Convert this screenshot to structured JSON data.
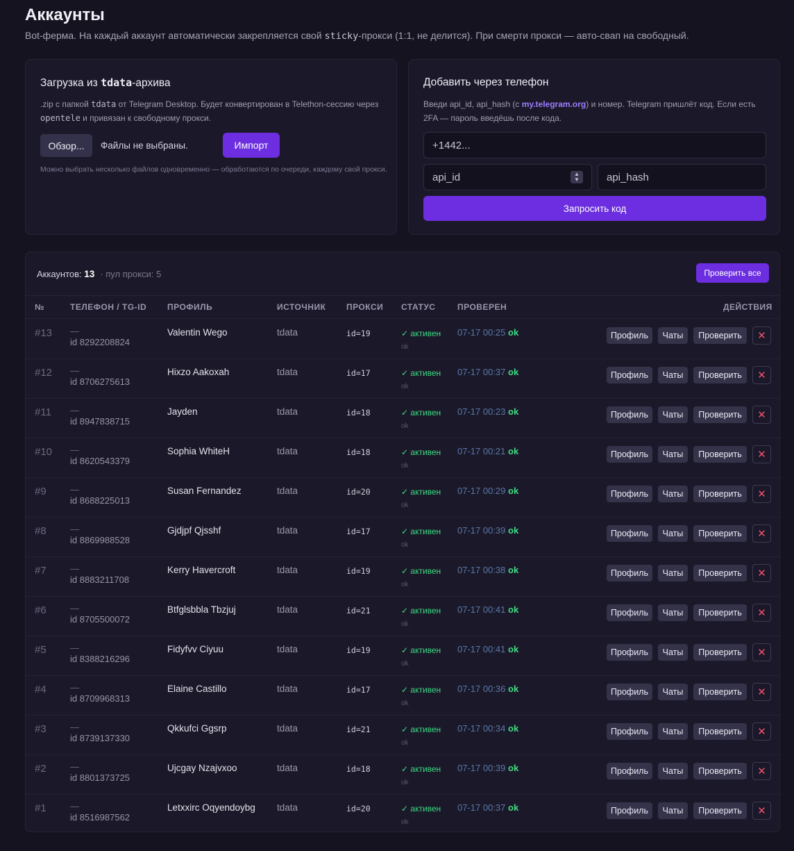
{
  "page": {
    "title": "Аккаунты",
    "subtitle_pre": "Bot-ферма. На каждый аккаунт автоматически закрепляется свой ",
    "subtitle_mono": "sticky",
    "subtitle_post": "-прокси (1:1, не делится). При смерти прокси — авто-свап на свободный."
  },
  "tdata_card": {
    "title_pre": "Загрузка из ",
    "title_mono": "tdata",
    "title_post": "-архива",
    "desc_1": ".zip с папкой ",
    "desc_mono1": "tdata",
    "desc_2": " от Telegram Desktop. Будет конвертирован в Telethon-сессию через ",
    "desc_mono2": "opentele",
    "desc_3": " и привязан к свободному прокси.",
    "browse_label": "Обзор...",
    "file_status": "Файлы не выбраны.",
    "import_label": "Импорт",
    "hint": "Можно выбрать несколько файлов одновременно — обработаются по очереди, каждому свой прокси."
  },
  "phone_card": {
    "title": "Добавить через телефон",
    "desc_1": "Введи api_id, api_hash (с ",
    "desc_link": "my.telegram.org",
    "desc_2": ") и номер. Telegram пришлёт код. Если есть 2FA — пароль введёшь после кода.",
    "phone_placeholder": "+1442...",
    "api_id_placeholder": "api_id",
    "api_hash_placeholder": "api_hash",
    "request_label": "Запросить код"
  },
  "table": {
    "accounts_label": "Аккаунтов:",
    "accounts_count": "13",
    "proxy_pool": "· пул прокси: 5",
    "check_all_label": "Проверить все",
    "headers": {
      "num": "№",
      "phone": "ТЕЛЕФОН / TG-ID",
      "profile": "ПРОФИЛЬ",
      "source": "ИСТОЧНИК",
      "proxy": "ПРОКСИ",
      "status": "СТАТУС",
      "checked": "ПРОВЕРЕН",
      "actions": "ДЕЙСТВИЯ"
    },
    "action_labels": {
      "profile": "Профиль",
      "chats": "Чаты",
      "check": "Проверить",
      "delete": "✕"
    },
    "rows": [
      {
        "num": "#13",
        "phone": "—",
        "tgid": "id 8292208824",
        "profile": "Valentin Wego",
        "source": "tdata",
        "proxy": "id=19",
        "status": "✓ активен",
        "status_sub": "ok",
        "checked": "07-17 00:25",
        "checked_ok": "ok"
      },
      {
        "num": "#12",
        "phone": "—",
        "tgid": "id 8706275613",
        "profile": "Hixzo Aakoxah",
        "source": "tdata",
        "proxy": "id=17",
        "status": "✓ активен",
        "status_sub": "ok",
        "checked": "07-17 00:37",
        "checked_ok": "ok"
      },
      {
        "num": "#11",
        "phone": "—",
        "tgid": "id 8947838715",
        "profile": "Jayden",
        "source": "tdata",
        "proxy": "id=18",
        "status": "✓ активен",
        "status_sub": "ok",
        "checked": "07-17 00:23",
        "checked_ok": "ok"
      },
      {
        "num": "#10",
        "phone": "—",
        "tgid": "id 8620543379",
        "profile": "Sophia WhiteH",
        "source": "tdata",
        "proxy": "id=18",
        "status": "✓ активен",
        "status_sub": "ok",
        "checked": "07-17 00:21",
        "checked_ok": "ok"
      },
      {
        "num": "#9",
        "phone": "—",
        "tgid": "id 8688225013",
        "profile": "Susan Fernandez",
        "source": "tdata",
        "proxy": "id=20",
        "status": "✓ активен",
        "status_sub": "ok",
        "checked": "07-17 00:29",
        "checked_ok": "ok"
      },
      {
        "num": "#8",
        "phone": "—",
        "tgid": "id 8869988528",
        "profile": "Gjdjpf Qjsshf",
        "source": "tdata",
        "proxy": "id=17",
        "status": "✓ активен",
        "status_sub": "ok",
        "checked": "07-17 00:39",
        "checked_ok": "ok"
      },
      {
        "num": "#7",
        "phone": "—",
        "tgid": "id 8883211708",
        "profile": "Kerry Havercroft",
        "source": "tdata",
        "proxy": "id=19",
        "status": "✓ активен",
        "status_sub": "ok",
        "checked": "07-17 00:38",
        "checked_ok": "ok"
      },
      {
        "num": "#6",
        "phone": "—",
        "tgid": "id 8705500072",
        "profile": "Btfglsbbla Tbzjuj",
        "source": "tdata",
        "proxy": "id=21",
        "status": "✓ активен",
        "status_sub": "ok",
        "checked": "07-17 00:41",
        "checked_ok": "ok"
      },
      {
        "num": "#5",
        "phone": "—",
        "tgid": "id 8388216296",
        "profile": "Fidyfvv Ciyuu",
        "source": "tdata",
        "proxy": "id=19",
        "status": "✓ активен",
        "status_sub": "ok",
        "checked": "07-17 00:41",
        "checked_ok": "ok"
      },
      {
        "num": "#4",
        "phone": "—",
        "tgid": "id 8709968313",
        "profile": "Elaine Castillo",
        "source": "tdata",
        "proxy": "id=17",
        "status": "✓ активен",
        "status_sub": "ok",
        "checked": "07-17 00:36",
        "checked_ok": "ok"
      },
      {
        "num": "#3",
        "phone": "—",
        "tgid": "id 8739137330",
        "profile": "Qkkufci Ggsrp",
        "source": "tdata",
        "proxy": "id=21",
        "status": "✓ активен",
        "status_sub": "ok",
        "checked": "07-17 00:34",
        "checked_ok": "ok"
      },
      {
        "num": "#2",
        "phone": "—",
        "tgid": "id 8801373725",
        "profile": "Ujcgay Nzajvxoo",
        "source": "tdata",
        "proxy": "id=18",
        "status": "✓ активен",
        "status_sub": "ok",
        "checked": "07-17 00:39",
        "checked_ok": "ok"
      },
      {
        "num": "#1",
        "phone": "—",
        "tgid": "id 8516987562",
        "profile": "Letxxirc Oqyendoybg",
        "source": "tdata",
        "proxy": "id=20",
        "status": "✓ активен",
        "status_sub": "ok",
        "checked": "07-17 00:37",
        "checked_ok": "ok"
      }
    ]
  },
  "colors": {
    "background": "#15131f",
    "card": "#1b1929",
    "accent": "#6c2ee0",
    "success": "#3ddc84",
    "danger": "#f0506e",
    "link": "#9d7cff"
  }
}
